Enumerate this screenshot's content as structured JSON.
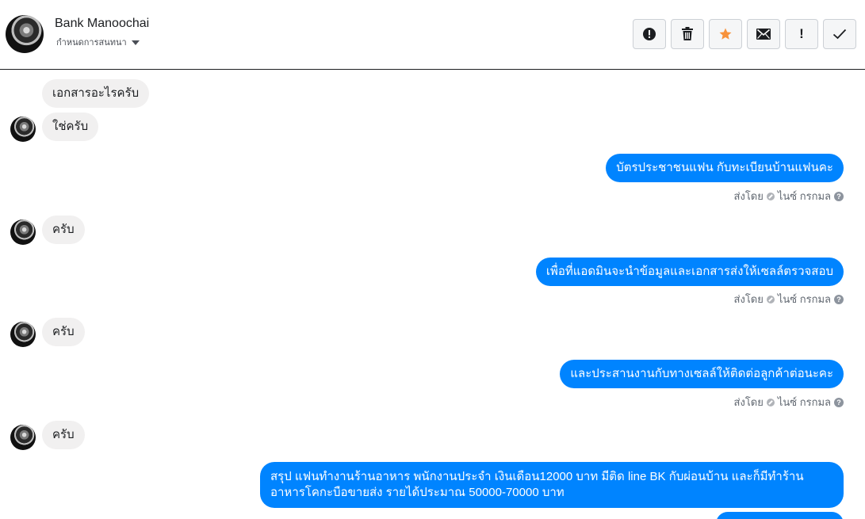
{
  "header": {
    "name": "Bank Manoochai",
    "subtitle": "กำหนดการสนทนา"
  },
  "toolbar": {
    "buttons": [
      {
        "icon": "alert-circle-icon"
      },
      {
        "icon": "trash-icon"
      },
      {
        "icon": "star-icon",
        "color": "#f7923b"
      },
      {
        "icon": "envelope-icon"
      },
      {
        "icon": "exclamation-icon",
        "label": "!"
      },
      {
        "icon": "checkmark-icon"
      }
    ]
  },
  "messages": [
    {
      "from": "them",
      "text": "เอกสารอะไรครับ"
    },
    {
      "from": "them",
      "text": "ใช่ครับ"
    },
    {
      "from": "me",
      "text": "บัตรประชาชนแฟน กับทะเบียนบ้านแฟนคะ"
    },
    {
      "from": "them",
      "text": "ครับ"
    },
    {
      "from": "me",
      "text": "เพื่อที่แอดมินจะนำข้อมูลและเอกสารส่งให้เซลล์ตรวจสอบ"
    },
    {
      "from": "them",
      "text": "ครับ"
    },
    {
      "from": "me",
      "text": "และประสานงานกับทางเซลล์ให้ติดต่อลูกค้าต่อนะคะ"
    },
    {
      "from": "them",
      "text": "ครับ"
    },
    {
      "from": "me",
      "text": "สรุป แฟนทำงานร้านอาหาร  พนักงานประจำ เงินเดือน12000 บาท มีติด line BK กับผ่อนบ้าน  และก็มีทำร้านอาหารโคกะบือขายส่ง รายได้ประมาณ 50000-70000 บาท"
    }
  ],
  "status": {
    "sent_by": "ส่งโดย",
    "sender": "ไนซ์ กรกมล",
    "help": "?"
  },
  "colors": {
    "outgoing": "#0084ff",
    "incoming": "#f1f0f0"
  }
}
